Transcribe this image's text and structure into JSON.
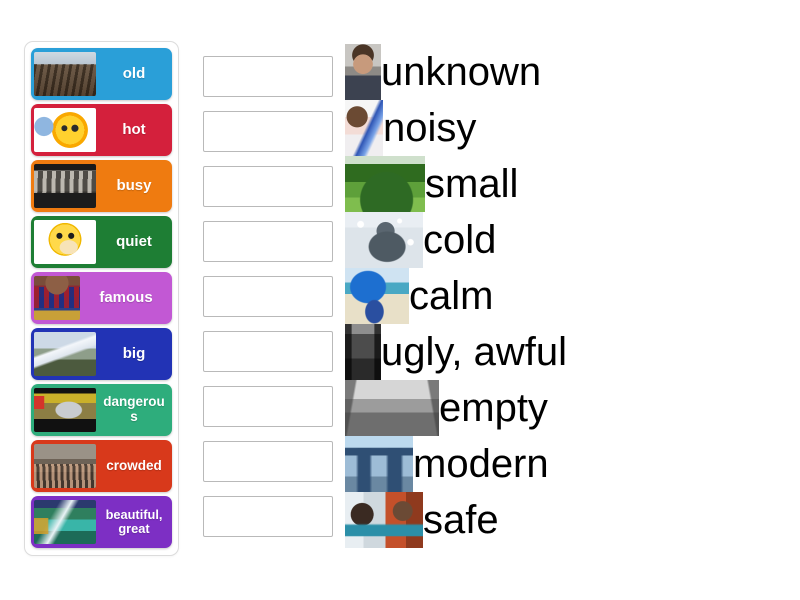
{
  "activity": {
    "type": "match-up-drag-and-drop",
    "background_color": "#ffffff"
  },
  "tiles_panel": {
    "border_color": "#dcdcdc",
    "tiles": [
      {
        "label": "old",
        "color": "#2a9fd8",
        "image": "old-building-photo",
        "lines": 1
      },
      {
        "label": "hot",
        "color": "#d4203c",
        "image": "cartoon-sun-sunglasses",
        "lines": 1
      },
      {
        "label": "busy",
        "color": "#ef7b10",
        "image": "busy-crowd-photo",
        "lines": 1
      },
      {
        "label": "quiet",
        "color": "#1e7e34",
        "image": "shushing-smiley-emoticon",
        "lines": 1
      },
      {
        "label": "famous",
        "color": "#c258d4",
        "image": "famous-footballer-photo",
        "lines": 1
      },
      {
        "label": "big",
        "color": "#2233b5",
        "image": "big-snowy-mountain-photo",
        "lines": 1
      },
      {
        "label": "dangerous",
        "color": "#2ead7c",
        "image": "car-crash-stunt-photo",
        "lines": 1
      },
      {
        "label": "crowded",
        "color": "#d8391b",
        "image": "crowded-street-market",
        "lines": 1
      },
      {
        "label": "beautiful,\ngreat",
        "color": "#7d2fc4",
        "image": "beautiful-lake-landscape",
        "lines": 2
      }
    ]
  },
  "drop_slots": {
    "count": 9,
    "value": "",
    "placeholder": "",
    "border_color": "#b9b9b9",
    "fill_color": "#ffffff"
  },
  "answers": {
    "items": [
      {
        "label": "unknown",
        "image": "portrait-unknown-man",
        "thumb_width": 36
      },
      {
        "label": "noisy",
        "image": "girl-with-megaphone",
        "thumb_width": 38
      },
      {
        "label": "small",
        "image": "small-green-hill",
        "thumb_width": 80
      },
      {
        "label": "cold",
        "image": "person-in-snow-winter",
        "thumb_width": 78
      },
      {
        "label": "calm",
        "image": "calm-beach-umbrella",
        "thumb_width": 64
      },
      {
        "label": "ugly, awful",
        "image": "ugly-grey-underpass",
        "thumb_width": 36
      },
      {
        "label": "empty",
        "image": "empty-street-black-white",
        "thumb_width": 94
      },
      {
        "label": "modern",
        "image": "modern-cctv-tower-beijing",
        "thumb_width": 68
      },
      {
        "label": "safe",
        "image": "safe-family-hug",
        "thumb_width": 78
      }
    ]
  }
}
